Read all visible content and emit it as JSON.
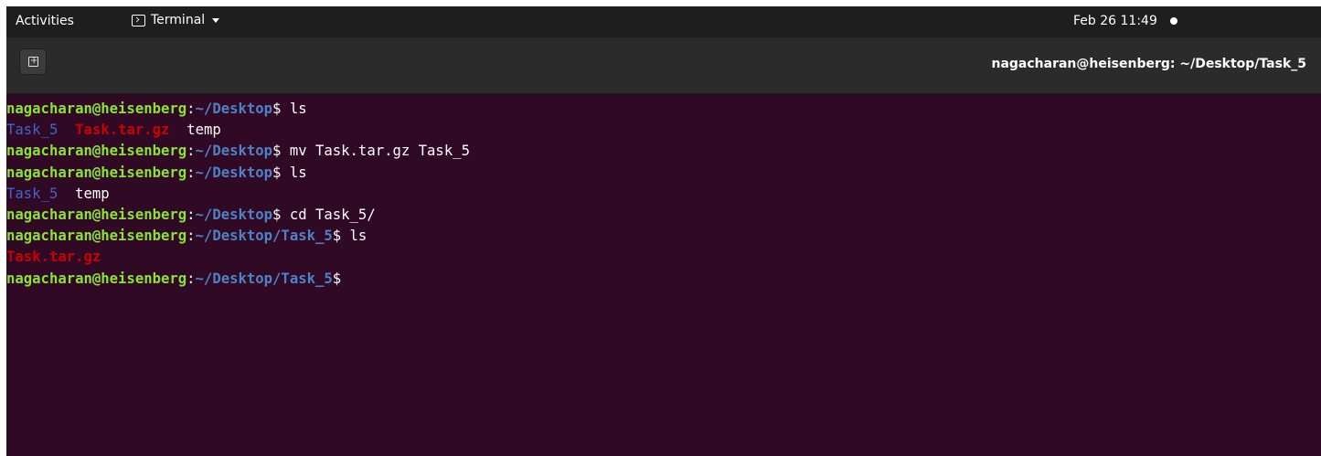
{
  "topbar": {
    "activities": "Activities",
    "app_menu": "Terminal",
    "clock": "Feb 26  11:49"
  },
  "window": {
    "title": "nagacharan@heisenberg: ~/Desktop/Task_5",
    "new_tab_icon": "new-tab-icon"
  },
  "terminal": {
    "lines": [
      {
        "user": "nagacharan@heisenberg",
        "sep": ":",
        "path": "~/Desktop",
        "dollar": "$ ",
        "cmd": "ls"
      },
      {
        "items": [
          "Task_5",
          "Task.tar.gz",
          "temp"
        ]
      },
      {
        "user": "nagacharan@heisenberg",
        "sep": ":",
        "path": "~/Desktop",
        "dollar": "$ ",
        "cmd": "mv Task.tar.gz Task_5"
      },
      {
        "user": "nagacharan@heisenberg",
        "sep": ":",
        "path": "~/Desktop",
        "dollar": "$ ",
        "cmd": "ls"
      },
      {
        "items": [
          "Task_5",
          "temp"
        ]
      },
      {
        "user": "nagacharan@heisenberg",
        "sep": ":",
        "path": "~/Desktop",
        "dollar": "$ ",
        "cmd": "cd Task_5/"
      },
      {
        "user": "nagacharan@heisenberg",
        "sep": ":",
        "path": "~/Desktop/Task_5",
        "dollar": "$ ",
        "cmd": "ls"
      },
      {
        "items": [
          "Task.tar.gz"
        ]
      },
      {
        "user": "nagacharan@heisenberg",
        "sep": ":",
        "path": "~/Desktop/Task_5",
        "dollar": "$",
        "cmd": ""
      }
    ]
  },
  "colors": {
    "background": "#300a24",
    "prompt_user": "#8ae234",
    "prompt_path": "#4e82c7",
    "directory": "#3e65c7",
    "archive": "#cc0000"
  }
}
